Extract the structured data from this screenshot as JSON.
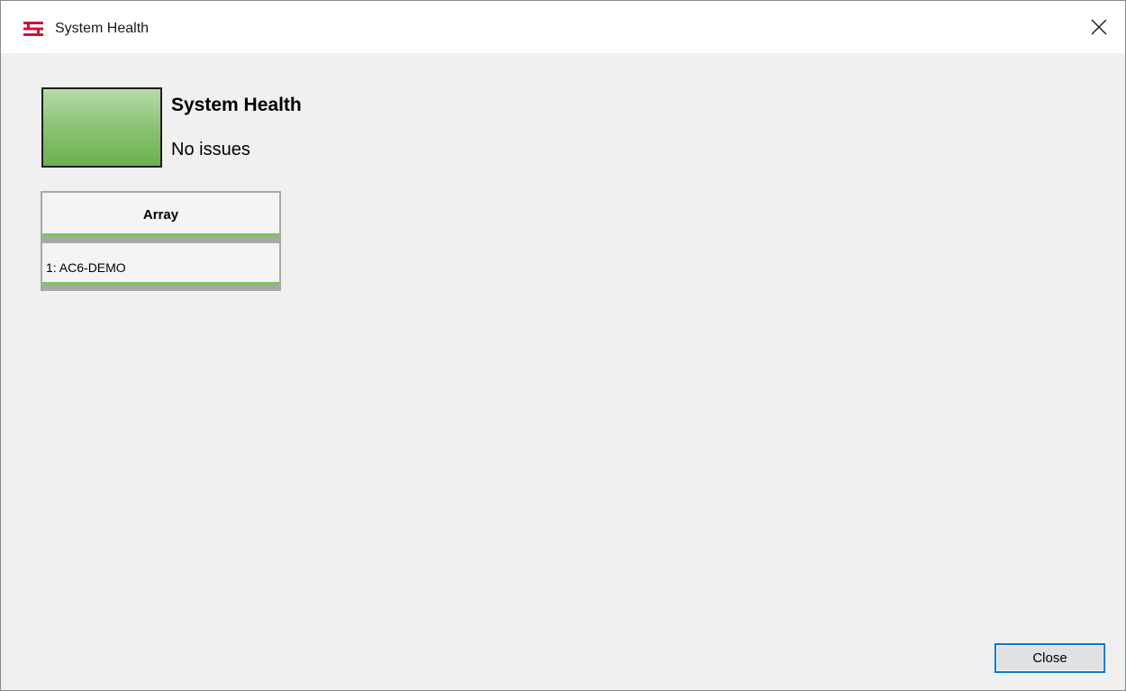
{
  "window": {
    "title": "System Health",
    "app_icon": "stacked-bars-app-icon",
    "close_icon": "close-x-icon"
  },
  "summary": {
    "title": "System Health",
    "status": "No issues",
    "status_color": "#8cc577"
  },
  "array_table": {
    "header": "Array",
    "rows": [
      {
        "label": "1: AC6-DEMO",
        "status_color": "#82c06a"
      }
    ]
  },
  "buttons": {
    "close_label": "Close"
  },
  "colors": {
    "accent": "#0078d7",
    "app_icon_red": "#d0103a",
    "health_ok": "#82c06a"
  }
}
